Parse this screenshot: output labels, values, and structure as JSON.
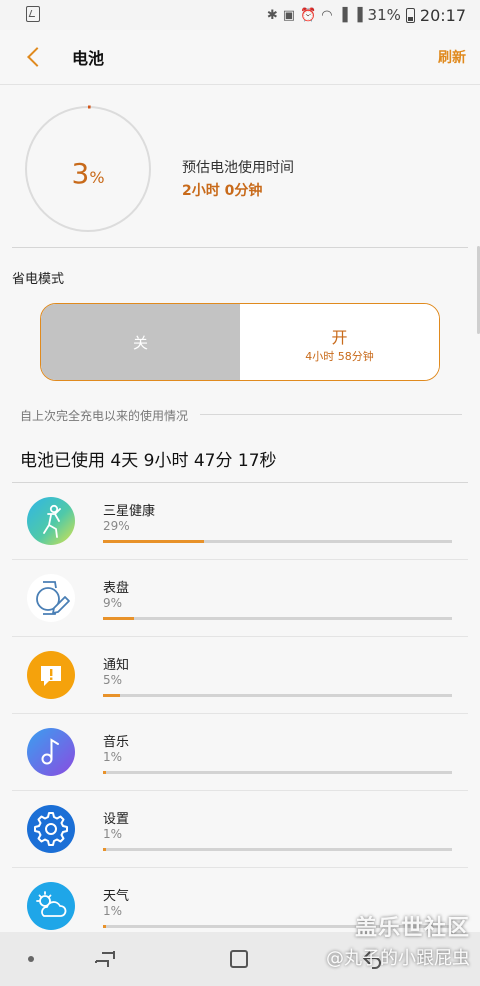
{
  "status_bar": {
    "battery_percent": "31%",
    "time": "20:17",
    "icons": [
      "bluetooth-icon",
      "nfc-icon",
      "alarm-icon",
      "wifi-icon",
      "signal-4g-icon",
      "signal-4g-icon",
      "battery-icon"
    ]
  },
  "header": {
    "title": "电池",
    "refresh_label": "刷新"
  },
  "battery": {
    "level": 3,
    "level_number": "3",
    "level_symbol": "%",
    "estimate_label": "预估电池使用时间",
    "estimate_value": "2小时 0分钟",
    "accent_color": "#c86a1a"
  },
  "power_saving": {
    "label": "省电模式",
    "off_label": "关",
    "on_label": "开",
    "on_sublabel": "4小时 58分钟",
    "selected": "off"
  },
  "usage": {
    "caption": "自上次完全充电以来的使用情况",
    "total": "电池已使用 4天 9小时 47分 17秒",
    "apps": [
      {
        "name": "三星健康",
        "percent_text": "29%",
        "fraction": 0.29,
        "icon": "samsung-health-icon"
      },
      {
        "name": "表盘",
        "percent_text": "9%",
        "fraction": 0.09,
        "icon": "watch-face-icon"
      },
      {
        "name": "通知",
        "percent_text": "5%",
        "fraction": 0.05,
        "icon": "notification-icon"
      },
      {
        "name": "音乐",
        "percent_text": "1%",
        "fraction": 0.01,
        "icon": "music-icon"
      },
      {
        "name": "设置",
        "percent_text": "1%",
        "fraction": 0.01,
        "icon": "settings-gear-icon"
      },
      {
        "name": "天气",
        "percent_text": "1%",
        "fraction": 0.01,
        "icon": "weather-icon"
      }
    ]
  },
  "watermark": {
    "line1": "盖乐世社区",
    "line2": "@丸子的小跟屁虫"
  }
}
